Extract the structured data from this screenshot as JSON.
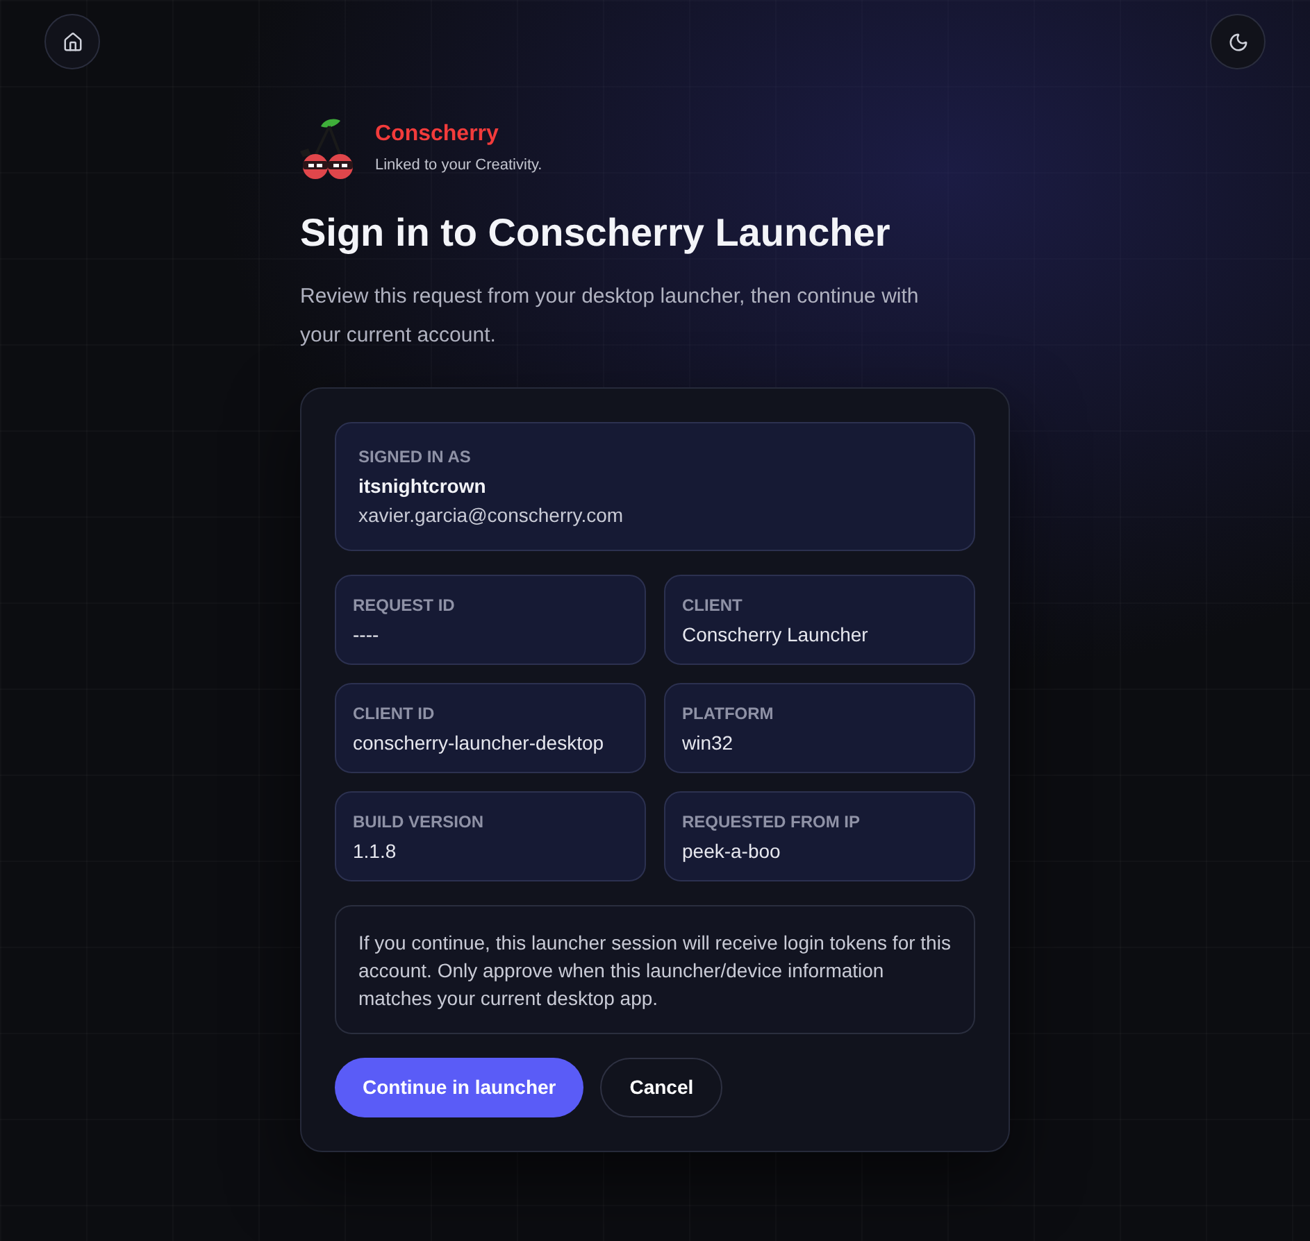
{
  "brand": {
    "name": "Conscherry",
    "tagline": "Linked to your Creativity."
  },
  "title": "Sign in to Conscherry Launcher",
  "description": "Review this request from your desktop launcher, then continue with your current account.",
  "card": {
    "account": {
      "label": "SIGNED IN AS",
      "username": "itsnightcrown",
      "email": "xavier.garcia@conscherry.com"
    },
    "details": [
      {
        "label": "REQUEST ID",
        "value": "----"
      },
      {
        "label": "CLIENT",
        "value": "Conscherry Launcher"
      },
      {
        "label": "CLIENT ID",
        "value": "conscherry-launcher-desktop"
      },
      {
        "label": "PLATFORM",
        "value": "win32"
      },
      {
        "label": "BUILD VERSION",
        "value": "1.1.8"
      },
      {
        "label": "REQUESTED FROM IP",
        "value": "peek-a-boo"
      }
    ],
    "notice": "If you continue, this launcher session will receive login tokens for this account. Only approve when this launcher/device information matches your current desktop app.",
    "buttons": [
      {
        "label": "Continue in launcher",
        "kind": "primary"
      },
      {
        "label": "Cancel",
        "kind": "secondary"
      }
    ]
  }
}
